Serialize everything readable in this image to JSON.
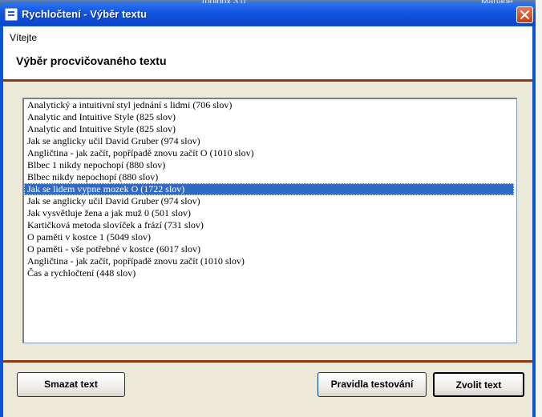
{
  "background": {
    "text_left": "Toolbox 3.0",
    "text_right": "Manage"
  },
  "window": {
    "title": "Rychločtení - Výběr textu",
    "accent_color": "#0a54d6",
    "separator_color": "#8b3a0f"
  },
  "header": {
    "welcome": "Vítejte",
    "subtitle": "Výběr procvičovaného textu"
  },
  "list": {
    "selected_index": 7,
    "items": [
      "Analytický a intuitivní styl jednání s lidmi (706 slov)",
      "Analytic and Intuitive Style (825 slov)",
      "Analytic and Intuitive Style (825 slov)",
      "Jak se anglicky učil David Gruber (974 slov)",
      "Angličtina - jak začít, popřípadě znovu začít O (1010 slov)",
      "Blbec 1 nikdy nepochopí (880 slov)",
      "Blbec nikdy nepochopí (880 slov)",
      "Jak se lidem vypne mozek O (1722 slov)",
      "Jak se anglicky učil David Gruber (974 slov)",
      "Jak vysvětluje žena a jak muž 0 (501 slov)",
      "Kartičková metoda slovíček a frází (731 slov)",
      "O paměti v kostce 1 (5049 slov)",
      "O paměti - vše potřebné v kostce (6017 slov)",
      "Angličtina - jak začít, popřípadě znovu začít (1010 slov)",
      "Čas a rychločtení (448 slov)"
    ]
  },
  "buttons": {
    "clear": "Smazat text",
    "rules": "Pravidla testování",
    "choose": "Zvolit text"
  }
}
